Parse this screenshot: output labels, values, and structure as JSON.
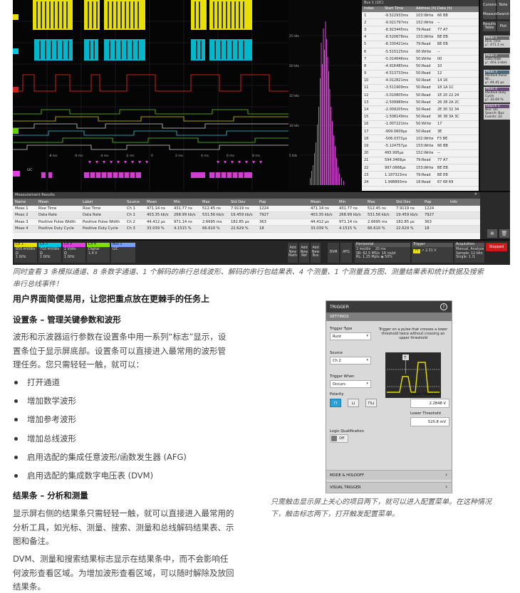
{
  "scope": {
    "histogram_labels": [
      "25 hits",
      "20 hits",
      "15 hits",
      "10 hits",
      "5 hits"
    ],
    "bus_table": {
      "title": "Bus 1 (I2C)",
      "columns": [
        "Index",
        "Start Time",
        "Address (h)",
        "Data (h)"
      ],
      "rows": [
        [
          "1",
          "-9.522933ms",
          "103:Write",
          "66 BB"
        ],
        [
          "2",
          "-9.021797ms",
          "152:Write",
          "--"
        ],
        [
          "3",
          "-8.923445ms",
          "79:Read",
          "77 A7"
        ],
        [
          "4",
          "-8.520678ms",
          "153:Write",
          "BE EB"
        ],
        [
          "5",
          "-8.330421ms",
          "79:Read",
          "BE EB"
        ],
        [
          "6",
          "-5.515125ms",
          "00:Write",
          "--"
        ],
        [
          "7",
          "-5.014646ms",
          "50:Write",
          "00"
        ],
        [
          "8",
          "-4.916485ms",
          "50:Read",
          "10"
        ],
        [
          "9",
          "-4.513733ms",
          "50:Read",
          "12"
        ],
        [
          "10",
          "-4.012821ms",
          "50:Read",
          "14 16"
        ],
        [
          "11",
          "-3.511909ms",
          "50:Read",
          "18 1A 1C"
        ],
        [
          "12",
          "-3.010805ms",
          "50:Read",
          "1E 20 22 24"
        ],
        [
          "13",
          "-2.509989ms",
          "50:Read",
          "26 28 2A 2C"
        ],
        [
          "14",
          "-2.009205ms",
          "50:Read",
          "2E 30 32 34"
        ],
        [
          "15",
          "-1.508149ms",
          "50:Read",
          "36 38 3A 3C"
        ],
        [
          "16",
          "-1.007221ms",
          "50:Write",
          "17"
        ],
        [
          "17",
          "-909.0609μs",
          "50:Read",
          "3E"
        ],
        [
          "18",
          "-506.0372μs",
          "102:Write",
          "F3 BE"
        ],
        [
          "19",
          "-5.124757μs",
          "153:Write",
          "66 BB"
        ],
        [
          "20",
          "495.995μs",
          "152:Write",
          "--"
        ],
        [
          "21",
          "594.3469μs",
          "79:Read",
          "77 A7"
        ],
        [
          "22",
          "997.0668μs",
          "153:Write",
          "BE EB"
        ],
        [
          "23",
          "1.187323ms",
          "79:Read",
          "BE EB"
        ],
        [
          "24",
          "1.998893ms",
          "18:Read",
          "67 68 69"
        ]
      ]
    },
    "side_buttons": [
      "Cursors",
      "Note",
      "Measure",
      "Search",
      "Results Table",
      "Plot"
    ],
    "meas_badges": [
      {
        "title": "Meas 1",
        "label": "Rise Time",
        "value": "μ': 471.1 ns"
      },
      {
        "title": "Meas 2",
        "label": "Data Rate",
        "value": "μ': 403.3 kb/s"
      },
      {
        "title": "Meas 3",
        "label": "Positive Pulse Wi...",
        "value": "μ': 44.41 μs"
      },
      {
        "title": "Meas 4",
        "label": "Positive Duty Cycle",
        "value": "μ': 33.04 %"
      },
      {
        "title": "Search 1",
        "label": "Bus: I2C",
        "value": "Search: Bus",
        "extra": "Events: 22"
      }
    ],
    "meas_table": {
      "title": "Measurement Results",
      "columns": [
        "Name",
        "Mean",
        "Label",
        "Source",
        "Mean",
        "Min",
        "Max",
        "Std Dev",
        "Pop",
        "Mean",
        "Min",
        "Max",
        "Std Dev",
        "Pop",
        "Info"
      ],
      "rows": [
        [
          "Meas 1",
          "Rise Time",
          "Rise Time",
          "Ch 1",
          "471.14 ns",
          "431.77 ns",
          "512.45 ns",
          "7.9119 ns",
          "1224",
          "471.14 ns",
          "431.77 ns",
          "512.45 ns",
          "7.9119 ns",
          "1224"
        ],
        [
          "Meas 2",
          "Data Rate",
          "Data Rate",
          "Ch 1",
          "403.35 kb/s",
          "268.99 kb/s",
          "531.56 kb/s",
          "19.459 kb/s",
          "7927",
          "403.35 kb/s",
          "268.99 kb/s",
          "531.56 kb/s",
          "19.459 kb/s",
          "7927"
        ],
        [
          "Meas 3",
          "Positive Pulse Width",
          "Positive Pulse Width",
          "Ch 2",
          "44.412 μs",
          "971.14 ns",
          "2.6695 ms",
          "182.85 μs",
          "363",
          "44.412 μs",
          "971.14 ns",
          "2.6695 ms",
          "182.85 μs",
          "363"
        ],
        [
          "Meas 4",
          "Positive Duty Cycle",
          "Positive Duty Cycle",
          "Ch 3",
          "33.039 %",
          "4.1515 %",
          "66.610 %",
          "22.629 %",
          "18",
          "33.039 %",
          "4.1515 %",
          "66.610 %",
          "22.629 %",
          "18"
        ]
      ]
    },
    "channels": [
      {
        "title": "Ch 1",
        "l1": "650 mV/div",
        "l2": "Ω",
        "l3": "1 GHz",
        "color": "#e8e000"
      },
      {
        "title": "Ch 2",
        "l1": "710 mV/div",
        "l2": "Ω",
        "l3": "1 GHz",
        "color": "#00c8e0"
      },
      {
        "title": "Ch 3",
        "l1": "2 V/div",
        "l2": "Ω",
        "l3": "1 GHz",
        "color": "#e040e0"
      },
      {
        "title": "Ch 4",
        "l1": "Digital",
        "l2": "1.4 V",
        "l3": "",
        "color": "#80e000"
      },
      {
        "title": "Bus 1",
        "l1": "I2C",
        "l2": "",
        "l3": "",
        "color": "#7aa0ff"
      }
    ],
    "add_buttons": [
      "Add New Math",
      "Add New Ref",
      "Add New Bus"
    ],
    "dvm_label": "DVM",
    "afg_label": "AFG",
    "horizontal": {
      "title": "Horizontal",
      "l1": "2 ms/div",
      "l1b": "20 ms",
      "l2": "SR: 62.5 MS/s",
      "l2b": "16 ns/pt",
      "l3": "RL: 1.25 Mpts",
      "l3b": "50%"
    },
    "trigger": {
      "title": "Trigger",
      "l1": "2.31 V"
    },
    "acquisition": {
      "title": "Acquisition",
      "l1": "Manual,",
      "l1b": "Analyze",
      "l2": "Sample: 12 bits",
      "l3": "Single: 1 /1"
    },
    "stopped_label": "Stopped"
  },
  "caption1": {
    "line1": "同时查看 3 条模拟通道、8 条数字通道、1 个解码的串行总线波形、解码的串行包结果表、4 个测量、1 个测量直方图、测量结果表和统计数据及搜索",
    "line2": "串行总线事件！"
  },
  "subhead": "用户界面简便易用，让您把重点放在更棘手的任务上",
  "section1": {
    "heading": "设置条 – 管理关键参数和波形",
    "para_lines": [
      "波形和示波器运行参数在设置条中用一系列“标志”显示，设",
      "置条位于显示屏底部。设置条可以直接进入最常用的波形管",
      "理任务。您只需轻轻一触，就可以："
    ],
    "bullets": [
      "打开通道",
      "增加数学波形",
      "增加参考波形",
      "增加总线波形",
      "启用选配的集成任意波形/函数发生器 (AFG)",
      "启用选配的集成数字电压表 (DVM)"
    ]
  },
  "section2": {
    "heading": "结果条 – 分析和测量",
    "para1_lines": [
      "显示屏右侧的结果条只需轻轻一触，就可以直接进入最常用的",
      "分析工具，如光标、测量、搜索、测量和总线解码结果表、示",
      "图和备注。"
    ],
    "para2_lines": [
      "DVM、测量和搜索结果标志显示在结果条中，而不会影响任",
      "何波形查看区域。为增加波形查看区域，可以随时解除及放回",
      "结果条。"
    ]
  },
  "trigger_panel": {
    "title": "TRIGGER",
    "settings": "SETTINGS",
    "trigger_type_label": "Trigger Type",
    "trigger_type_value": "Runt",
    "description": "Trigger on a pulse that crosses a lower threshold twice without crossing an upper threshold",
    "source_label": "Source",
    "source_value": "Ch 2",
    "trigger_when_label": "Trigger When",
    "trigger_when_value": "Occurs",
    "polarity_label": "Polarity",
    "upper_label": "Upper Threshold",
    "upper_value": "2.2848 V",
    "lower_label": "Lower Threshold",
    "lower_value": "520.8 mV",
    "logic_label": "Logic Qualification",
    "logic_value": "Off",
    "menu1": "MODE & HOLDOFF",
    "menu2": "VISUAL TRIGGER"
  },
  "caption2": {
    "line1": "只需触击显示屏上关心的项目两下，就可以进入配置菜单。在这种情况",
    "line2": "下，触击标志两下，打开触发配置菜单。"
  }
}
